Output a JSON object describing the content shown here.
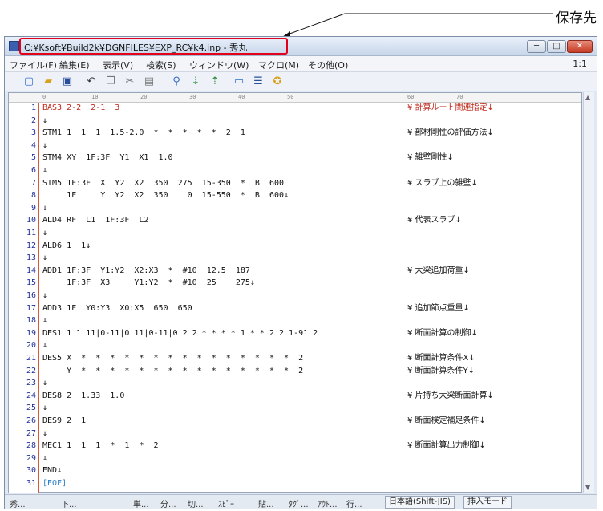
{
  "annotation": {
    "label": "保存先"
  },
  "window": {
    "title": "C:¥Ksoft¥Build2k¥DGNFILES¥EXP_RC¥k4.inp - 秀丸",
    "min_label": "─",
    "max_label": "□",
    "close_label": "✕"
  },
  "menu": {
    "items": [
      "ファイル(F)",
      "編集(E)",
      "表示(V)",
      "検索(S)",
      "ウィンドウ(W)",
      "マクロ(M)",
      "その他(O)"
    ],
    "zoom": "1:1"
  },
  "toolbar": {
    "icons": [
      "new-file-icon",
      "open-folder-icon",
      "save-icon",
      "undo-icon",
      "copy-icon",
      "cut-icon",
      "paste-icon",
      "search-icon",
      "search-next-icon",
      "search-prev-icon",
      "window-icon",
      "split-icon",
      "settings-icon"
    ]
  },
  "ruler": {
    "ticks": [
      "0",
      "10",
      "20",
      "30",
      "40",
      "50",
      "60",
      "70"
    ]
  },
  "editor": {
    "lines": [
      {
        "n": "1",
        "code": "BAS3 2-2  2-1  3",
        "comment": "¥ 計算ルート関連指定↓",
        "red": true
      },
      {
        "n": "2",
        "code": "↓",
        "comment": ""
      },
      {
        "n": "3",
        "code": "STM1 1  1  1  1.5-2.0  *  *  *  *  *  2  1",
        "comment": "¥ 部材剛性の評価方法↓"
      },
      {
        "n": "4",
        "code": "↓",
        "comment": ""
      },
      {
        "n": "5",
        "code": "STM4 XY  1F:3F  Y1  X1  1.0",
        "comment": "¥ 雑壁剛性↓"
      },
      {
        "n": "6",
        "code": "↓",
        "comment": ""
      },
      {
        "n": "7",
        "code": "STM5 1F:3F  X  Y2  X2  350  275  15-350  *  B  600",
        "comment": "¥ スラブ上の雑壁↓"
      },
      {
        "n": "8",
        "code": "     1F     Y  Y2  X2  350    0  15-550  *  B  600↓",
        "comment": ""
      },
      {
        "n": "9",
        "code": "↓",
        "comment": ""
      },
      {
        "n": "10",
        "code": "ALD4 RF  L1  1F:3F  L2",
        "comment": "¥ 代表スラブ↓"
      },
      {
        "n": "11",
        "code": "↓",
        "comment": ""
      },
      {
        "n": "12",
        "code": "ALD6 1  1↓",
        "comment": ""
      },
      {
        "n": "13",
        "code": "↓",
        "comment": ""
      },
      {
        "n": "14",
        "code": "ADD1 1F:3F  Y1:Y2  X2:X3  *  #10  12.5  187",
        "comment": "¥ 大梁追加荷重↓"
      },
      {
        "n": "15",
        "code": "     1F:3F  X3     Y1:Y2  *  #10  25    275↓",
        "comment": ""
      },
      {
        "n": "16",
        "code": "↓",
        "comment": ""
      },
      {
        "n": "17",
        "code": "ADD3 1F  Y0:Y3  X0:X5  650  650",
        "comment": "¥ 追加節点重量↓"
      },
      {
        "n": "18",
        "code": "↓",
        "comment": ""
      },
      {
        "n": "19",
        "code": "DES1 1 1 11|0-11|0 11|0-11|0 2 2 * * * * 1 * * 2 2 1-91 2",
        "comment": "¥ 断面計算の制御↓"
      },
      {
        "n": "20",
        "code": "↓",
        "comment": ""
      },
      {
        "n": "21",
        "code": "DES5 X  *  *  *  *  *  *  *  *  *  *  *  *  *  *  *  2",
        "comment": "¥ 断面計算条件X↓"
      },
      {
        "n": "22",
        "code": "     Y  *  *  *  *  *  *  *  *  *  *  *  *  *  *  *  2",
        "comment": "¥ 断面計算条件Y↓"
      },
      {
        "n": "23",
        "code": "↓",
        "comment": ""
      },
      {
        "n": "24",
        "code": "DES8 2  1.33  1.0",
        "comment": "¥ 片持ち大梁断面計算↓"
      },
      {
        "n": "25",
        "code": "↓",
        "comment": ""
      },
      {
        "n": "26",
        "code": "DES9 2  1",
        "comment": "¥ 断面検定補足条件↓"
      },
      {
        "n": "27",
        "code": "↓",
        "comment": ""
      },
      {
        "n": "28",
        "code": "MEC1 1  1  1  *  1  *  2",
        "comment": "¥ 断面計算出力制御↓"
      },
      {
        "n": "29",
        "code": "↓",
        "comment": ""
      },
      {
        "n": "30",
        "code": "END↓",
        "comment": ""
      },
      {
        "n": "31",
        "code": "[EOF]",
        "comment": "",
        "eof": true
      }
    ]
  },
  "statusbar": {
    "items": [
      "秀...",
      "下...",
      "単...",
      "分...",
      "切...",
      "ｽﾋﾟｰ",
      "貼...",
      "ﾀｸﾞ...",
      "ｱｳﾄ...",
      "行..."
    ],
    "encoding": "日本語(Shift-JIS)",
    "mode": "挿入モード"
  }
}
